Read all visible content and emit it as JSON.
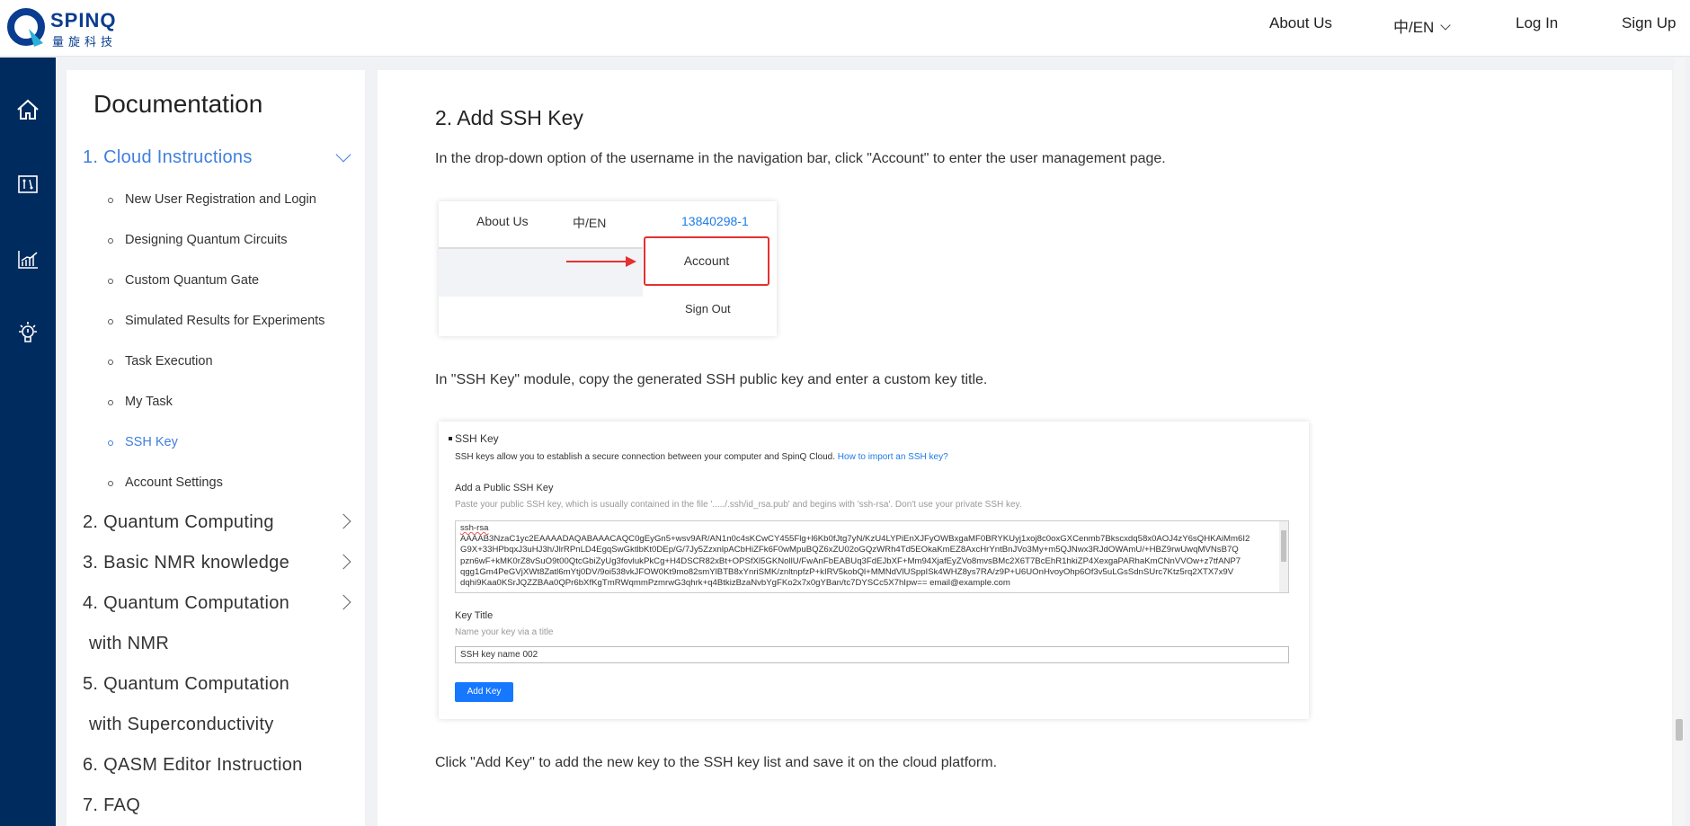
{
  "header": {
    "logo_text": "SPINQ",
    "logo_subtext": "量旋科技",
    "nav": [
      "About Us",
      "中/EN",
      "Log In",
      "Sign Up"
    ]
  },
  "rail": {
    "icons": [
      "home-icon",
      "circuit-icon",
      "chart-icon",
      "lightbulb-icon"
    ]
  },
  "docs": {
    "title": "Documentation",
    "active_section": {
      "label": "1. Cloud Instructions",
      "items": [
        "New User Registration and Login",
        "Designing Quantum Circuits",
        "Custom Quantum Gate",
        "Simulated Results for Experiments",
        "Task Execution",
        "My Task",
        "SSH Key",
        "Account Settings"
      ],
      "active_item": "SSH Key"
    },
    "sections": [
      "2. Quantum Computing",
      "3. Basic NMR knowledge",
      "4. Quantum Computation",
      "with NMR",
      "5. Quantum Computation",
      "with Superconductivity",
      "6. QASM Editor Instruction",
      "7. FAQ"
    ],
    "accent": "#3f7fe0"
  },
  "content": {
    "title": "2. Add SSH Key",
    "p1": "In the drop-down option of the username in the navigation bar, click \"Account\" to enter the user management page.",
    "shot1": {
      "about": "About Us",
      "lang": "中/EN",
      "user": "13840298-1",
      "account": "Account",
      "signout": "Sign Out"
    },
    "p2": "In \"SSH Key\" module, copy the generated SSH public key and enter a custom key title.",
    "shot2": {
      "heading": "SSH Key",
      "desc": "SSH keys allow you to establish a secure connection between your computer and SpinQ Cloud.",
      "link": "How to import an SSH key?",
      "add_label": "Add a Public SSH Key",
      "hint": "Paste your public SSH key, which is usually contained in the file '...../.ssh/id_rsa.pub' and begins with 'ssh-rsa'. Don't use your private SSH key.",
      "key_lines": [
        "ssh-rsa",
        "AAAAB3NzaC1yc2EAAAADAQABAAACAQC0gEyGn5+wsv9AR/AN1n0c4sKCwCY455Flg+l6Kb0fJtg7yN/KzU4LYPiEnXJFyOWBxgaMF0BRYKUyj1xoj8c0oxGXCenmb7Bkscxdq58x0AOJ4zY6sQHKAiMm6I2",
        "G9X+33HPbqxJ3uHJ3h/JlrRPnLD4EgqSwGktlbKt0DEp/G/7Jy5ZzxnlpACbHiZFk6F0wMpuBQZ6xZU02oGQzWRh4Td5EOkaKmEZ8AxcHrYntBnJVo3My+m5QJNwx3RJdOWAmU/+HBZ9rwUwqMVNsB7Q",
        "pzn6wF+kMK0rZ8vSuO9t00QtcGbiZyUg3fovlukPkCg+H4DSCR82xBt+OPSfXl5GKNollU/FwAnFbEABUq3FdEJbXF+Mm94XjafEyZVo8mvsBMc2X6T7BcEhR1hkiZP4XexgaPARhaKmCNnVVOw+z7tfANP7",
        "qgg1Gm4PeGVjXWt8Zatl6mYtj0DV/9oi538vkJFOW0Kt9mo82smYlBTB8xYnriSMK/znltnpfzP+kIRV5kobQl+MMNdVlUSppISk4WHZ8ys7RA/z9P+U6UOnHvoyOhp6Of3v5uLGsSdnSUrc7Ktz5rq2XTX7x9V",
        "dqhi9Kaa0KSrJQZZBAa0QPr6bXfKgTmRWqmmPzmrwG3qhrk+q4BtkizBzaNvbYgFKo2x7x0gYBan/tc7DYSCc5X7hIpw== email@example.com"
      ],
      "title_label": "Key Title",
      "title_hint": "Name your key via a title",
      "title_value": "SSH key name 002",
      "button": "Add Key"
    },
    "p3": "Click \"Add Key\" to add the new key to the SSH key list and save it on the cloud platform."
  }
}
